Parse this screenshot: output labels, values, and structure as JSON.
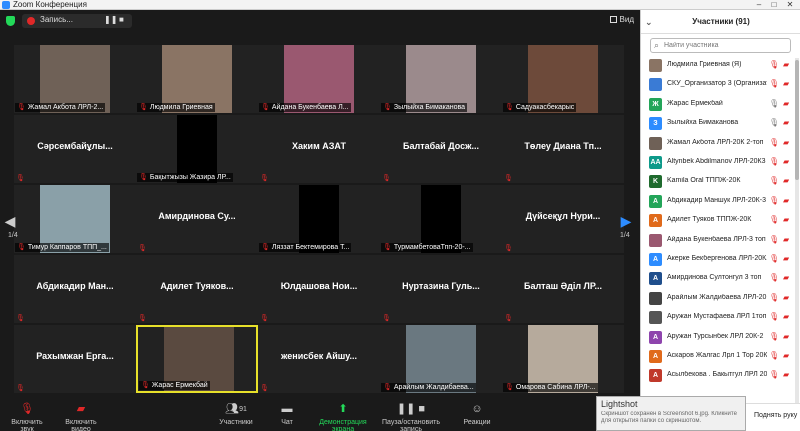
{
  "window": {
    "title": "Zoom Конференция"
  },
  "recording": {
    "label": "Запись..."
  },
  "view_label": "Вид",
  "pages": {
    "left": "1/4",
    "right": "1/4"
  },
  "tiles": [
    {
      "name": "",
      "label": "Жамал Акбота ЛРЛ-2...",
      "video": "#6f6157"
    },
    {
      "name": "",
      "label": "Людмила Гриевная",
      "video": "#8a7464"
    },
    {
      "name": "",
      "label": "Айдана Букенбаева Л...",
      "video": "#9a5870"
    },
    {
      "name": "",
      "label": "Зылыйха Бимаканова",
      "video": "#9b8a8c"
    },
    {
      "name": "",
      "label": "Садуакасбекарыс",
      "video": "#6d4a3a"
    },
    {
      "name": "Сәрсембайұлы...",
      "label": "",
      "video": ""
    },
    {
      "name": "",
      "label": "Бақытжызы Жазира ЛР...",
      "video": "#000000"
    },
    {
      "name": "Хаким АЗАТ",
      "label": "",
      "video": ""
    },
    {
      "name": "Балтабай Досж...",
      "label": "",
      "video": ""
    },
    {
      "name": "Төлеу Диана Тп...",
      "label": "",
      "video": ""
    },
    {
      "name": "",
      "label": "Тимур Каппаров ТПП_...",
      "video": "#8aa0a8"
    },
    {
      "name": "Амирдинова Су...",
      "label": "",
      "video": ""
    },
    {
      "name": "",
      "label": "Ляззат Бектемирова Т...",
      "video": "#000000"
    },
    {
      "name": "",
      "label": "ТурмамбетоваТпп-20-...",
      "video": "#000000"
    },
    {
      "name": "Дүйсеқұл Нури...",
      "label": "",
      "video": ""
    },
    {
      "name": "Абдикадир Ман...",
      "label": "",
      "video": ""
    },
    {
      "name": "Адилет Туяков...",
      "label": "",
      "video": ""
    },
    {
      "name": "Юлдашова Нои...",
      "label": "",
      "video": ""
    },
    {
      "name": "Нуртазина Гуль...",
      "label": "",
      "video": ""
    },
    {
      "name": "Балташ Әділ ЛР...",
      "label": "",
      "video": ""
    },
    {
      "name": "Рахымжан Ерга...",
      "label": "",
      "video": ""
    },
    {
      "name": "",
      "label": "Жарас Ермекбай",
      "video": "#5a4a40"
    },
    {
      "name": "женисбек Айшу...",
      "label": "",
      "video": ""
    },
    {
      "name": "",
      "label": "Арайлым Жалдибаева...",
      "video": "#6a7880"
    },
    {
      "name": "",
      "label": "Омарова Сабина ЛРЛ-...",
      "video": "#b6aa9c"
    }
  ],
  "toolbar": {
    "audio": "Включить звук",
    "video": "Включить видео",
    "participants": "Участники",
    "participants_count": "91",
    "chat": "Чат",
    "share": "Демонстрация экрана",
    "record": "Пауза/остановить запись",
    "reactions": "Реакции"
  },
  "lightshot": {
    "title": "Lightshot",
    "message": "Скриншот сохранен в Screenshot 6.jpg. Кликните для открытия папки со скриншотом."
  },
  "panel": {
    "title": "Участники (91)",
    "search_placeholder": "Найти участника",
    "raise_hand": "Поднять руку",
    "participants": [
      {
        "name": "Людмила Гриевная (Я)",
        "initial": "",
        "color": "#8a7464",
        "mic": "muted"
      },
      {
        "name": "СКУ_Организатор 3 (Организатор)",
        "initial": "",
        "color": "#3a7bd5",
        "mic": "muted"
      },
      {
        "name": "Жарас Ермекбай",
        "initial": "Ж",
        "color": "#23a559",
        "mic": "on"
      },
      {
        "name": "Зылыйха Бимаканова",
        "initial": "З",
        "color": "#2d8cff",
        "mic": "on"
      },
      {
        "name": "Жамал Акбота ЛРЛ-20К 2-топ",
        "initial": "",
        "color": "#6f6157",
        "mic": "muted"
      },
      {
        "name": "Altynbek Abdilmanov ЛРЛ-20К3",
        "initial": "AA",
        "color": "#0e9a8a",
        "mic": "muted"
      },
      {
        "name": "Kamila Oral ТППЖ-20К",
        "initial": "K",
        "color": "#1f6b2e",
        "mic": "muted"
      },
      {
        "name": "Абдикадир Маншук ЛРЛ-20К-3",
        "initial": "А",
        "color": "#23a559",
        "mic": "muted"
      },
      {
        "name": "Адилет Туяков ТППЖ-20К",
        "initial": "А",
        "color": "#e06a1b",
        "mic": "muted"
      },
      {
        "name": "Айдана Букенбаева ЛРЛ-3 топ",
        "initial": "",
        "color": "#9a5870",
        "mic": "muted"
      },
      {
        "name": "Акерке Бекбергенова ЛРЛ-20К...",
        "initial": "А",
        "color": "#2d8cff",
        "mic": "muted"
      },
      {
        "name": "Амирдинова Султонгул 3 топ",
        "initial": "А",
        "color": "#1f4e8c",
        "mic": "muted"
      },
      {
        "name": "Арайлым Жалдибаева ЛРЛ-20К",
        "initial": "",
        "color": "#444444",
        "mic": "muted"
      },
      {
        "name": "Аружан Мустафаева ЛРЛ 1топ...",
        "initial": "",
        "color": "#555555",
        "mic": "muted"
      },
      {
        "name": "Аружан Турсынбек ЛРЛ 20К-2",
        "initial": "А",
        "color": "#8e44ad",
        "mic": "muted"
      },
      {
        "name": "Аскаров Жалгас Лрл 1 Тор 20К",
        "initial": "А",
        "color": "#e06a1b",
        "mic": "muted"
      },
      {
        "name": "Асылбекова . Бакытгул ЛРЛ 20К",
        "initial": "А",
        "color": "#c0392b",
        "mic": "muted"
      }
    ]
  },
  "colors": {
    "accent": "#2d8cff",
    "muted": "#e02828",
    "active_speaker": "#e7e02a",
    "share": "#23d959"
  }
}
